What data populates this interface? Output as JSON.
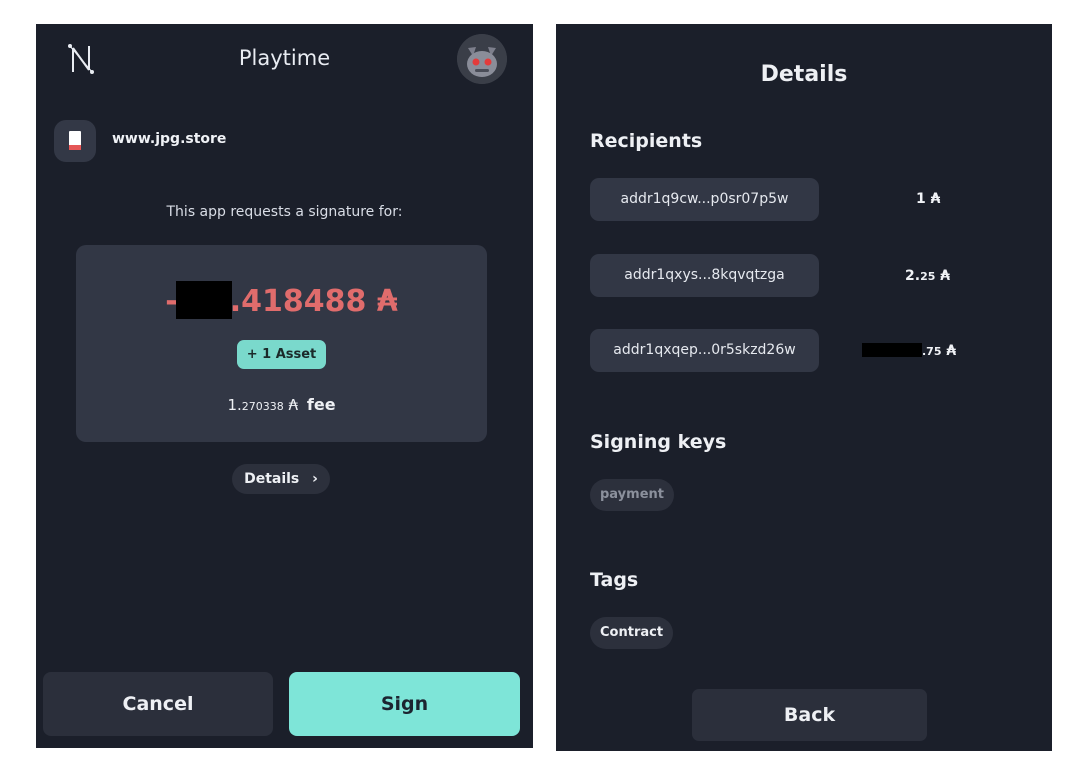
{
  "left": {
    "title": "Playtime",
    "site": "www.jpg.store",
    "request_text": "This app requests a signature for:",
    "amount_prefix": "-",
    "amount_suffix": ".418488 ₳",
    "asset_badge": "+ 1 Asset",
    "fee_int": "1.",
    "fee_dec": "270338",
    "fee_symbol": "₳",
    "fee_label": "fee",
    "details_label": "Details",
    "details_chevron": "›",
    "cancel_label": "Cancel",
    "sign_label": "Sign"
  },
  "right": {
    "title": "Details",
    "recipients_title": "Recipients",
    "recipients": [
      {
        "address": "addr1q9cw...p0sr07p5w",
        "amount_main": "1",
        "amount_small": "",
        "symbol": "₳"
      },
      {
        "address": "addr1qxys...8kqvqtzga",
        "amount_main": "2.",
        "amount_small": "25",
        "symbol": "₳"
      },
      {
        "address": "addr1qxqep...0r5skzd26w",
        "amount_main": "",
        "amount_small": ".75",
        "symbol": "₳"
      }
    ],
    "signing_keys_title": "Signing keys",
    "signing_key": "payment",
    "tags_title": "Tags",
    "tag": "Contract",
    "back_label": "Back"
  },
  "colors": {
    "panel_bg": "#1b1f2a",
    "card_bg": "#323745",
    "accent": "#7ee5d8",
    "amount_red": "#e06c6c",
    "muted": "#8b909c"
  },
  "icons": [
    "wallet-logo-icon",
    "monster-avatar-icon",
    "document-icon",
    "chevron-right-icon"
  ]
}
